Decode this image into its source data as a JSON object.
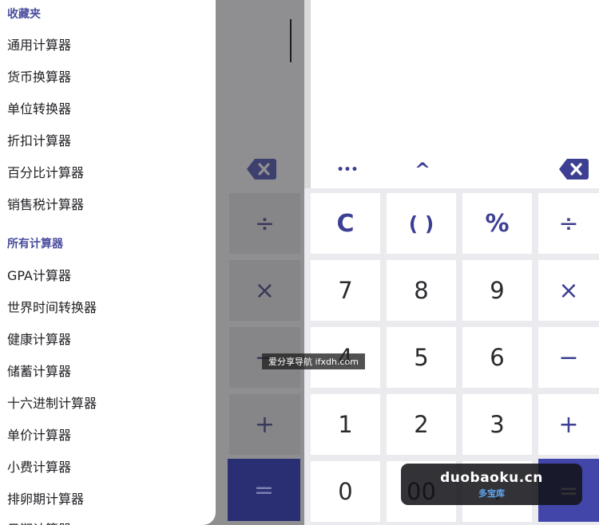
{
  "drawer": {
    "favorites_title": "收藏夹",
    "favorites": [
      "通用计算器",
      "货币换算器",
      "单位转换器",
      "折扣计算器",
      "百分比计算器",
      "销售税计算器"
    ],
    "all_title": "所有计算器",
    "all": [
      "GPA计算器",
      "世界时间转换器",
      "健康计算器",
      "储蓄计算器",
      "十六进制计算器",
      "单价计算器",
      "小费计算器",
      "排卵期计算器",
      "日期计算器"
    ]
  },
  "background_keys": {
    "divide": "÷",
    "multiply": "×",
    "minus": "−",
    "plus": "+",
    "equals": "="
  },
  "toolbar": {
    "more": "•••",
    "power": "^",
    "backspace": "backspace-icon"
  },
  "keys": {
    "row1": [
      "C",
      "( )",
      "%",
      "÷"
    ],
    "row2": [
      "7",
      "8",
      "9",
      "×"
    ],
    "row3": [
      "4",
      "5",
      "6",
      "−"
    ],
    "row4": [
      "1",
      "2",
      "3",
      "+"
    ],
    "row5": [
      "0",
      "00",
      ".",
      "="
    ]
  },
  "watermarks": {
    "small": "爱分享导航 ifxdh.com",
    "brand": "duobaoku.cn",
    "brand_sub": "多宝库"
  },
  "colors": {
    "accent": "#3d3f93",
    "equals": "#4346a9",
    "section_title": "#4a4d9c"
  }
}
